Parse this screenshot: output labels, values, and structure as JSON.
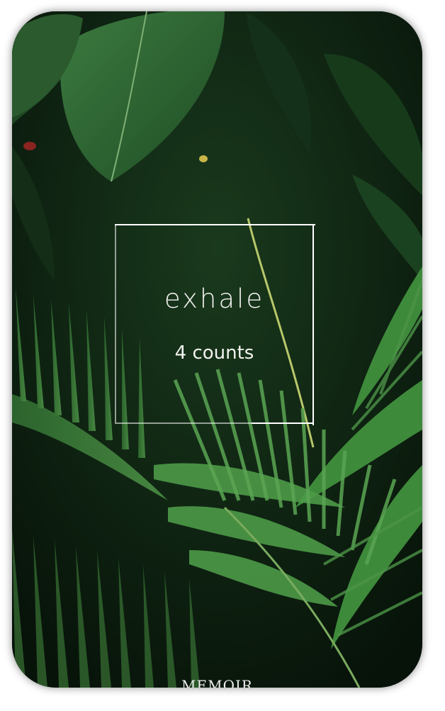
{
  "exercise": {
    "phase": "exhale",
    "count_text": "4 counts",
    "progress_fraction": 0.8
  },
  "brand": {
    "name": "MEMOIR"
  },
  "colors": {
    "background_foliage": "#1f4a24",
    "frame_line": "#ffffff",
    "text": "#f2f2f0"
  }
}
